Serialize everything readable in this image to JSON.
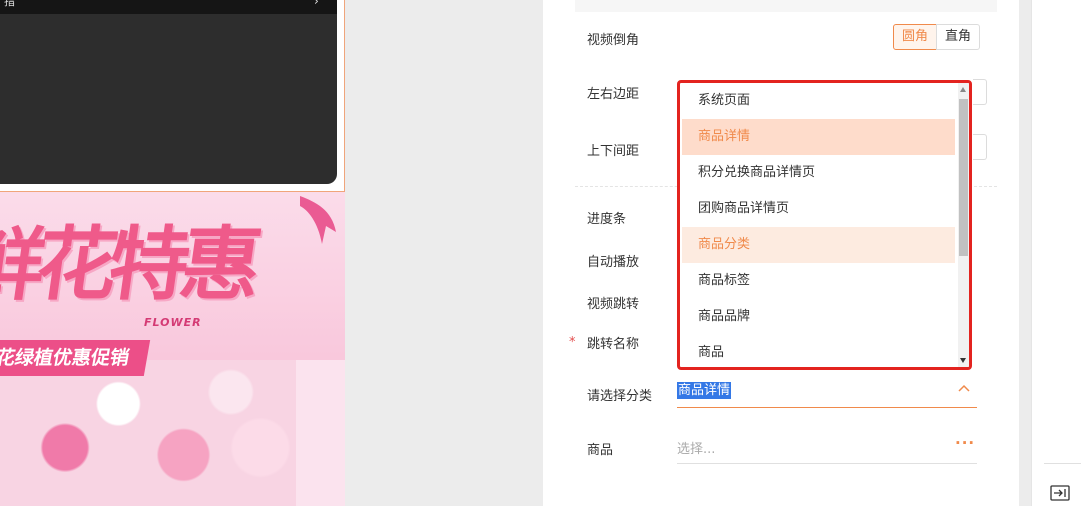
{
  "preview": {
    "video_bar_text": "指",
    "video_bar_arrow": "›",
    "banner_title": "鲜花特惠",
    "banner_subtitle": "FLOWER",
    "banner_tag": "花绿植优惠促销"
  },
  "settings": {
    "video_corner": {
      "label": "视频倒角",
      "options": [
        "圆角",
        "直角"
      ],
      "selected": "圆角"
    },
    "side_margin_label": "左右边距",
    "vertical_spacing_label": "上下间距",
    "progress_label": "进度条",
    "autoplay_label": "自动播放",
    "video_jump_label": "视频跳转",
    "jump_name": {
      "label": "跳转名称",
      "required_mark": "*"
    },
    "category": {
      "label": "请选择分类",
      "value": "商品详情"
    },
    "goods": {
      "label": "商品",
      "placeholder": "选择...",
      "more": "···"
    }
  },
  "dropdown": {
    "items": [
      "系统页面",
      "商品详情",
      "积分兑换商品详情页",
      "团购商品详情页",
      "商品分类",
      "商品标签",
      "商品品牌",
      "商品"
    ],
    "selected": "商品详情",
    "hovered": "商品分类",
    "highlight_color": "#e3231f"
  },
  "accent_color": "#f08a4b"
}
